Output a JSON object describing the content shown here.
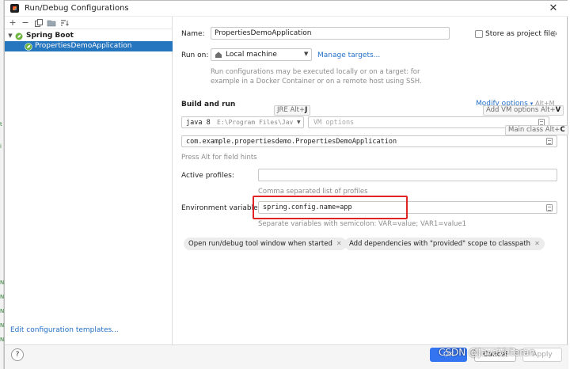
{
  "window": {
    "title": "Run/Debug Configurations",
    "close_glyph": "✕"
  },
  "left_panel": {
    "toolbar": {
      "add": "+",
      "remove": "−"
    },
    "tree": {
      "group_label": "Spring Boot",
      "item_label": "PropertiesDemoApplication"
    },
    "edit_templates_link": "Edit configuration templates..."
  },
  "form": {
    "name_label": "Name:",
    "name_value": "PropertiesDemoApplication",
    "store_as_project_file": "Store as project file",
    "run_on_label": "Run on:",
    "run_on_value": "Local machine",
    "manage_targets_link": "Manage targets...",
    "run_on_description": [
      "Run configurations may be executed locally or on a target: for",
      "example in a Docker Container or on a remote host using SSH."
    ],
    "build_and_run": {
      "section_title": "Build and run",
      "modify_options_link": "Modify options",
      "modify_options_shortcut": "Alt+M",
      "jre_tooltip_text": "JRE Alt+",
      "jre_tooltip_key": "J",
      "vm_tooltip_text": "Add VM options Alt+",
      "vm_tooltip_key": "V",
      "main_class_tooltip_text": "Main class Alt+",
      "main_class_tooltip_key": "C",
      "jre_version": "java 8",
      "jre_path": "E:\\Program Files\\Jav",
      "vm_options_placeholder": "VM options",
      "main_class_value": "com.example.propertiesdemo.PropertiesDemoApplication",
      "field_hints": "Press Alt for field hints"
    },
    "active_profiles_label": "Active profiles:",
    "active_profiles_value": "",
    "active_profiles_hint": "Comma separated list of profiles",
    "env_vars_label": "Environment variables:",
    "env_vars_value": "spring.config.name=app",
    "env_vars_hint": "Separate variables with semicolon: VAR=value; VAR1=value1",
    "option_chips": [
      "Open run/debug tool window when started",
      "Add dependencies with \"provided\" scope to classpath"
    ],
    "chip_close_glyph": "✕"
  },
  "footer": {
    "help": "?",
    "ok_label": "OK",
    "cancel_label": "Cancel",
    "apply_label": "Apply"
  },
  "watermark": "CSDN @JavaVeteran",
  "colors": {
    "selection": "#2675bf",
    "link": "#2470c8",
    "ok_button": "#3574f0",
    "highlight_box": "#e02424",
    "spring_green": "#6db33f"
  }
}
